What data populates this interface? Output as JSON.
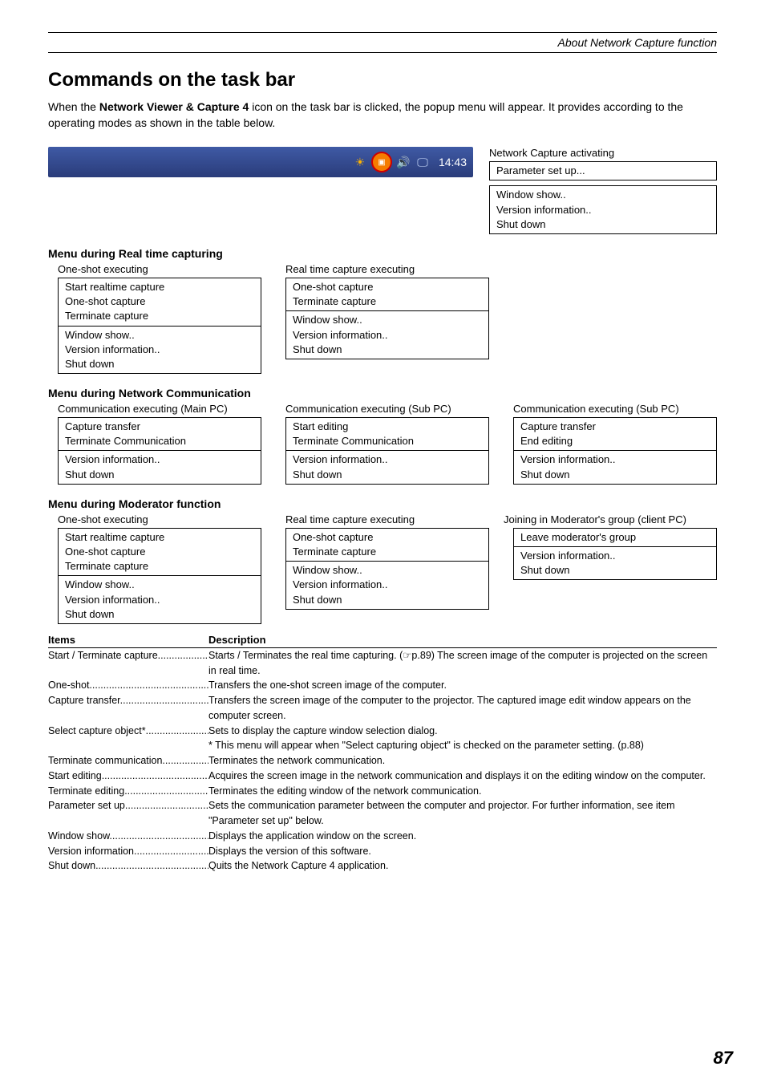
{
  "header": {
    "section_title": "About Network Capture function"
  },
  "title": "Commands on the task bar",
  "intro_pre": "When the ",
  "intro_bold": "Network Viewer & Capture 4",
  "intro_post": " icon on the task bar is clicked, the popup menu will appear. It provides according to the operating modes as shown in the table below.",
  "taskbar": {
    "time": "14:43"
  },
  "activating": {
    "label": "Network Capture activating",
    "box1": "Parameter set up...",
    "box2a": "Window show..",
    "box2b": "Version information..",
    "box2c": "Shut down"
  },
  "realtime": {
    "heading": "Menu during Real time capturing",
    "left_label": "One-shot executing",
    "left": {
      "a": "Start realtime capture",
      "b": "One-shot capture",
      "c": "Terminate capture",
      "d": "Window show..",
      "e": "Version information..",
      "f": "Shut down"
    },
    "mid_label": "Real time capture executing",
    "mid": {
      "a": "One-shot capture",
      "b": "Terminate capture",
      "c": "Window show..",
      "d": "Version information..",
      "e": "Shut down"
    }
  },
  "netcomm": {
    "heading": "Menu during Network Communication",
    "l1": "Communication executing (Main PC)",
    "l2": "Communication executing (Sub PC)",
    "l3": "Communication executing (Sub PC)",
    "b1": {
      "a": "Capture transfer",
      "b": "Terminate Communication",
      "c": "Version information..",
      "d": "Shut down"
    },
    "b2": {
      "a": "Start editing",
      "b": "Terminate Communication",
      "c": "Version information..",
      "d": "Shut down"
    },
    "b3": {
      "a": "Capture transfer",
      "b": "End editing",
      "c": "Version information..",
      "d": "Shut down"
    }
  },
  "moderator": {
    "heading": "Menu during Moderator function",
    "left_label": "One-shot executing",
    "left": {
      "a": "Start realtime capture",
      "b": "One-shot capture",
      "c": "Terminate capture",
      "d": "Window show..",
      "e": "Version information..",
      "f": "Shut down"
    },
    "mid_label": "Real time capture executing",
    "mid": {
      "a": "One-shot capture",
      "b": "Terminate capture",
      "c": "Window show..",
      "d": "Version information..",
      "e": "Shut down"
    },
    "right_label": "Joining in Moderator's group (client PC)",
    "right": {
      "a": "Leave moderator's group",
      "b": "Version information..",
      "c": "Shut down"
    }
  },
  "table": {
    "h1": "Items",
    "h2": "Description",
    "rows": [
      {
        "label": "Start  / Terminate capture...................",
        "text": "Starts / Terminates the real time capturing. (☞p.89) The screen image of the computer is projected on the screen in real time."
      },
      {
        "label": "One-shot............................................",
        "text": "Transfers the one-shot screen image of the computer."
      },
      {
        "label": "Capture transfer.................................",
        "text": "Transfers the screen image of the computer to the projector. The captured image edit window appears on the computer screen."
      },
      {
        "label": "Select capture object*..........................",
        "text": "Sets to display the capture window selection dialog."
      },
      {
        "label": "",
        "text": "* This menu will appear when \"Select capturing object\" is checked on the parameter setting. (p.88)"
      },
      {
        "label": "Terminate communication..................",
        "text": "Terminates the network communication."
      },
      {
        "label": "Start editing......................................",
        "text": "Acquires the screen image in the network communication and displays it on the editing window on the computer."
      },
      {
        "label": "Terminate editing..............................",
        "text": "Terminates the editing window of the network communication."
      },
      {
        "label": "Parameter set up...............................",
        "text": "Sets the communication parameter between the computer and projector. For further information, see item \"Parameter set up\" below."
      },
      {
        "label": "Window show....................................",
        "text": "Displays the application window on the screen."
      },
      {
        "label": "Version information............................",
        "text": "Displays the version of this software."
      },
      {
        "label": "Shut down..........................................",
        "text": "Quits the Network Capture 4 application."
      }
    ]
  },
  "page": "87"
}
